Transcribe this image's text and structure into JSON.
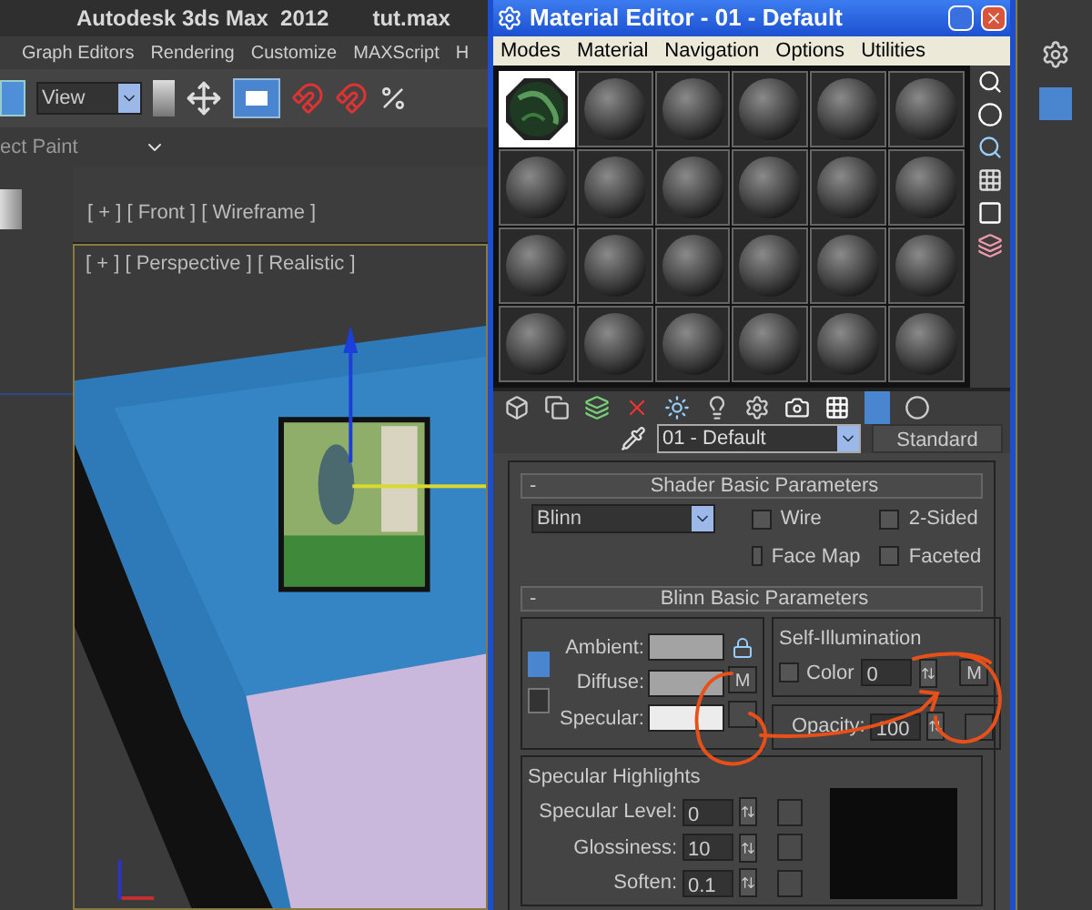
{
  "app": {
    "title": "Autodesk 3ds Max  2012",
    "file": "tut.max",
    "menu": [
      "Graph Editors",
      "Rendering",
      "Customize",
      "MAXScript",
      "H"
    ],
    "view_dropdown": "View",
    "ribbon_label": "ect Paint",
    "front_viewport": {
      "label": "[ + ] [ Front ] [ Wireframe ]"
    },
    "perspective_viewport": {
      "label": "[ + ] [ Perspective ] [ Realistic ]"
    }
  },
  "material_editor": {
    "title": "Material Editor - 01 - Default",
    "menu": [
      "Modes",
      "Material",
      "Navigation",
      "Options",
      "Utilities"
    ],
    "sample_slots": [
      {
        "kind": "texture",
        "selected": true
      },
      {
        "kind": "standard",
        "selected": false
      },
      {
        "kind": "standard",
        "selected": false
      },
      {
        "kind": "standard",
        "selected": false
      },
      {
        "kind": "standard",
        "selected": false
      },
      {
        "kind": "standard",
        "selected": false
      },
      {
        "kind": "standard",
        "selected": false
      },
      {
        "kind": "standard",
        "selected": false
      },
      {
        "kind": "standard",
        "selected": false
      },
      {
        "kind": "standard",
        "selected": false
      },
      {
        "kind": "standard",
        "selected": false
      },
      {
        "kind": "standard",
        "selected": false
      },
      {
        "kind": "standard",
        "selected": false
      },
      {
        "kind": "standard",
        "selected": false
      },
      {
        "kind": "standard",
        "selected": false
      },
      {
        "kind": "standard",
        "selected": false
      },
      {
        "kind": "standard",
        "selected": false
      },
      {
        "kind": "standard",
        "selected": false
      },
      {
        "kind": "standard",
        "selected": false
      },
      {
        "kind": "standard",
        "selected": false
      },
      {
        "kind": "standard",
        "selected": false
      },
      {
        "kind": "standard",
        "selected": false
      },
      {
        "kind": "standard",
        "selected": false
      },
      {
        "kind": "standard",
        "selected": false
      }
    ],
    "material_name": "01 - Default",
    "material_type": "Standard",
    "shader_rollout": {
      "toggle": "-",
      "title": "Shader Basic Parameters",
      "shader": "Blinn",
      "options": [
        {
          "label": "Wire",
          "checked": false
        },
        {
          "label": "2-Sided",
          "checked": false
        },
        {
          "label": "Face Map",
          "checked": false
        },
        {
          "label": "Faceted",
          "checked": false
        }
      ]
    },
    "blinn_rollout": {
      "toggle": "-",
      "title": "Blinn Basic Parameters",
      "colors": [
        {
          "label": "Ambient:",
          "color": "#a3a3a3"
        },
        {
          "label": "Diffuse:",
          "color": "#a3a3a3"
        },
        {
          "label": "Specular:",
          "color": "#ececec"
        }
      ],
      "map_button": "M",
      "self_illumination": {
        "title": "Self-Illumination",
        "label": "Color",
        "checked": false,
        "value": "0",
        "map_button": "M"
      },
      "opacity": {
        "label": "Opacity:",
        "value": "100"
      },
      "specular_highlights": {
        "title": "Specular Highlights",
        "fields": [
          {
            "label": "Specular Level:",
            "value": "0"
          },
          {
            "label": "Glossiness:",
            "value": "10"
          },
          {
            "label": "Soften:",
            "value": "0.1"
          }
        ]
      }
    }
  }
}
